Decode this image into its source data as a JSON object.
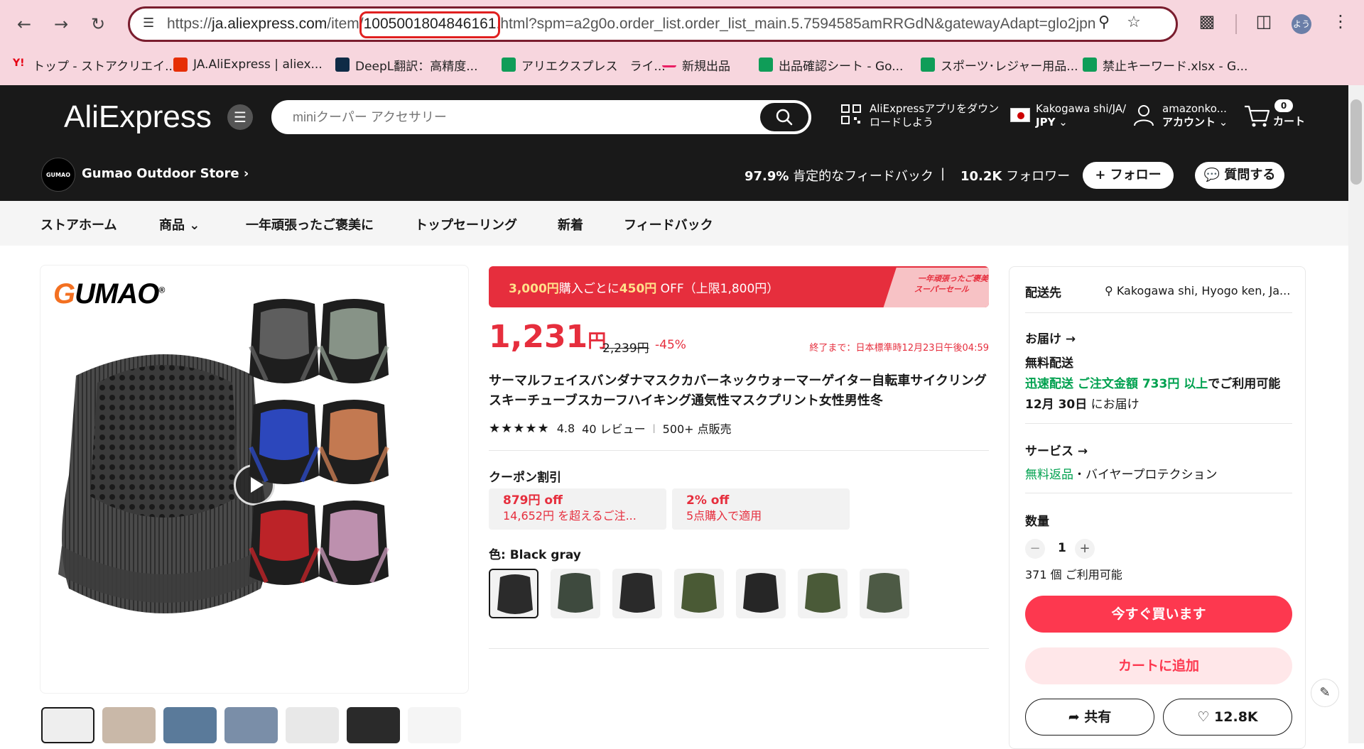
{
  "browser": {
    "url_prefix": "https://",
    "url_host": "ja.aliexpress.com",
    "url_path": "/item/",
    "url_item_id": "1005001804846161",
    "url_suffix": ".html?spm=a2g0o.order_list.order_list_main.5.7594585amRRGdN&gatewayAdapt=glo2jpn",
    "avatar_text": "よう",
    "bookmarks": [
      {
        "label": "トップ - ストアクリエイ...",
        "color": "#e60012"
      },
      {
        "label": "JA.AliExpress | aliex...",
        "color": "#e62e04"
      },
      {
        "label": "DeepL翻訳：高精度...",
        "color": "#0f2b46"
      },
      {
        "label": "アリエクスプレス　ライ...",
        "color": "#0f9d58"
      },
      {
        "label": "新規出品",
        "color": "#e91e63"
      },
      {
        "label": "出品確認シート - Go...",
        "color": "#0f9d58"
      },
      {
        "label": "スポーツ･レジャー用品...",
        "color": "#0f9d58"
      },
      {
        "label": "禁止キーワード.xlsx - G...",
        "color": "#0f9d58"
      }
    ]
  },
  "header": {
    "logo": "AliExpress",
    "search_placeholder": "miniクーパー アクセサリー",
    "app_line1": "AliExpressアプリをダウン",
    "app_line2": "ロードしよう",
    "region_line1": "Kakogawa shi/JA/",
    "region_line2": "JPY",
    "account_line1": "amazonko...",
    "account_line2": "アカウント",
    "cart_count": "0",
    "cart_label": "カート"
  },
  "store": {
    "logo_text": "GUMAO",
    "name": "Gumao Outdoor Store",
    "feedback_pct": "97.9%",
    "feedback_label": "肯定的なフィードバック",
    "sep": "|",
    "followers": "10.2K",
    "followers_label": "フォロワー",
    "follow_btn": "+ フォロー",
    "ask_btn": "質問する"
  },
  "store_nav": [
    "ストアホーム",
    "商品",
    "一年頑張ったご褒美に",
    "トップセーリング",
    "新着",
    "フィードバック"
  ],
  "gallery": {
    "brand_a": "G",
    "brand_b": "UMAO",
    "reg": "®"
  },
  "product": {
    "promo_a": "3,000円",
    "promo_b": "購入ごとに",
    "promo_c": "450円",
    "promo_d": " OFF（上限1,800円）",
    "promo_tag_line1": "一年頑張ったご褒美に",
    "promo_tag_line2": "スーパーセール",
    "price": "1,231",
    "price_unit": "円",
    "original_price": "2,239円",
    "discount": "-45%",
    "ends_label": "終了まで：",
    "ends_value": "日本標準時12月23日午後04:59",
    "title": "サーマルフェイスバンダナマスクカバーネックウォーマーゲイター自転車サイクリングスキーチューブスカーフハイキング通気性マスクプリント女性男性冬",
    "stars": "★★★★★",
    "rating": "4.8",
    "reviews": "40 レビュー",
    "sold": "500+ 点販売",
    "coupon_heading": "クーポン割引",
    "coupons": [
      {
        "amount": "879円 off",
        "condition": "14,652円 を超えるご注..."
      },
      {
        "amount": "2% off",
        "condition": "5点購入で適用"
      }
    ],
    "color_label": "色: Black gray",
    "swatch_colors": [
      "#2b2b2b",
      "#3e4a3e",
      "#2a2a2a",
      "#4a5a35",
      "#262626",
      "#4a5a38",
      "#4d5a45"
    ]
  },
  "panel": {
    "ship_to_label": "配送先",
    "ship_to_value": "Kakogawa shi, Hyogo ken, Ja...",
    "delivery_label": "お届け →",
    "free_shipping": "無料配送",
    "fast_ship": "迅速配送 ご注文金額 733円 以上",
    "fast_ship_tail": "でご利用可能",
    "delivery_date": "12月 30日",
    "delivery_date_tail": " にお届け",
    "service_label": "サービス →",
    "free_returns": "無料返品",
    "buyer_protection": "・バイヤープロテクション",
    "qty_label": "数量",
    "qty_value": "1",
    "available": "371 個 ご利用可能",
    "buy_now": "今すぐ買います",
    "add_to_cart": "カートに追加",
    "share": "共有",
    "wishlist": "12.8K"
  },
  "colors": {
    "accent_red": "#fd384f",
    "price_red": "#e62e3d",
    "header_bg": "#191919",
    "chrome_bg": "#f7d6de",
    "green": "#00a14f"
  }
}
